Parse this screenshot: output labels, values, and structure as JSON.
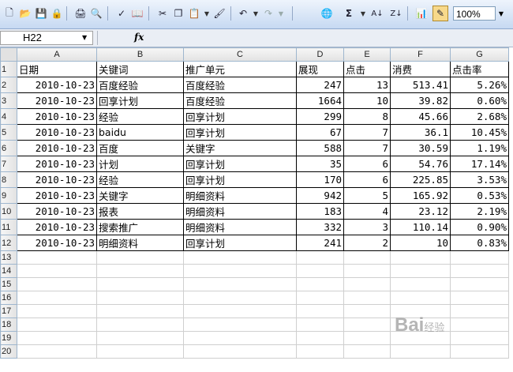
{
  "toolbar": {
    "icons": [
      "new-icon",
      "open-icon",
      "save-icon",
      "permission-icon",
      "print-icon",
      "print-preview-icon",
      "spelling-icon",
      "research-icon",
      "cut-icon",
      "copy-icon",
      "paste-icon",
      "format-painter-icon",
      "undo-icon",
      "redo-icon",
      "hyperlink-icon",
      "autosum-icon",
      "sort-ascending-icon",
      "sort-descending-icon",
      "chart-wizard-icon",
      "drawing-icon"
    ],
    "sum_symbol": "Σ",
    "zoom_value": "100%"
  },
  "formula_bar": {
    "name_box": "H22",
    "fx_label": "fx",
    "content": ""
  },
  "columns": [
    "A",
    "B",
    "C",
    "D",
    "E",
    "F",
    "G"
  ],
  "header_row": {
    "row": "1",
    "cells": [
      "日期",
      "关键词",
      "推广单元",
      "展现",
      "点击",
      "消费",
      "点击率"
    ]
  },
  "rows": [
    {
      "row": "2",
      "date": "2010-10-23",
      "keyword": "百度经验",
      "unit": "百度经验",
      "impressions": "247",
      "clicks": "13",
      "cost": "513.41",
      "ctr": "5.26%"
    },
    {
      "row": "3",
      "date": "2010-10-23",
      "keyword": "回享计划",
      "unit": "百度经验",
      "impressions": "1664",
      "clicks": "10",
      "cost": "39.82",
      "ctr": "0.60%"
    },
    {
      "row": "4",
      "date": "2010-10-23",
      "keyword": "经验",
      "unit": "回享计划",
      "impressions": "299",
      "clicks": "8",
      "cost": "45.66",
      "ctr": "2.68%"
    },
    {
      "row": "5",
      "date": "2010-10-23",
      "keyword": "baidu",
      "unit": "回享计划",
      "impressions": "67",
      "clicks": "7",
      "cost": "36.1",
      "ctr": "10.45%"
    },
    {
      "row": "6",
      "date": "2010-10-23",
      "keyword": "百度",
      "unit": "关键字",
      "impressions": "588",
      "clicks": "7",
      "cost": "30.59",
      "ctr": "1.19%"
    },
    {
      "row": "7",
      "date": "2010-10-23",
      "keyword": "计划",
      "unit": "回享计划",
      "impressions": "35",
      "clicks": "6",
      "cost": "54.76",
      "ctr": "17.14%"
    },
    {
      "row": "8",
      "date": "2010-10-23",
      "keyword": "经验",
      "unit": "回享计划",
      "impressions": "170",
      "clicks": "6",
      "cost": "225.85",
      "ctr": "3.53%"
    },
    {
      "row": "9",
      "date": "2010-10-23",
      "keyword": "关键字",
      "unit": "明细资料",
      "impressions": "942",
      "clicks": "5",
      "cost": "165.92",
      "ctr": "0.53%"
    },
    {
      "row": "10",
      "date": "2010-10-23",
      "keyword": "报表",
      "unit": "明细资料",
      "impressions": "183",
      "clicks": "4",
      "cost": "23.12",
      "ctr": "2.19%"
    },
    {
      "row": "11",
      "date": "2010-10-23",
      "keyword": "搜索推广",
      "unit": "明细资料",
      "impressions": "332",
      "clicks": "3",
      "cost": "110.14",
      "ctr": "0.90%"
    },
    {
      "row": "12",
      "date": "2010-10-23",
      "keyword": "明细资料",
      "unit": "回享计划",
      "impressions": "241",
      "clicks": "2",
      "cost": "10",
      "ctr": "0.83%"
    }
  ],
  "empty_rows": [
    "13",
    "14",
    "15",
    "16",
    "17",
    "18",
    "19",
    "20"
  ],
  "watermark": {
    "brand": "Bai",
    "suffix": "经验"
  }
}
